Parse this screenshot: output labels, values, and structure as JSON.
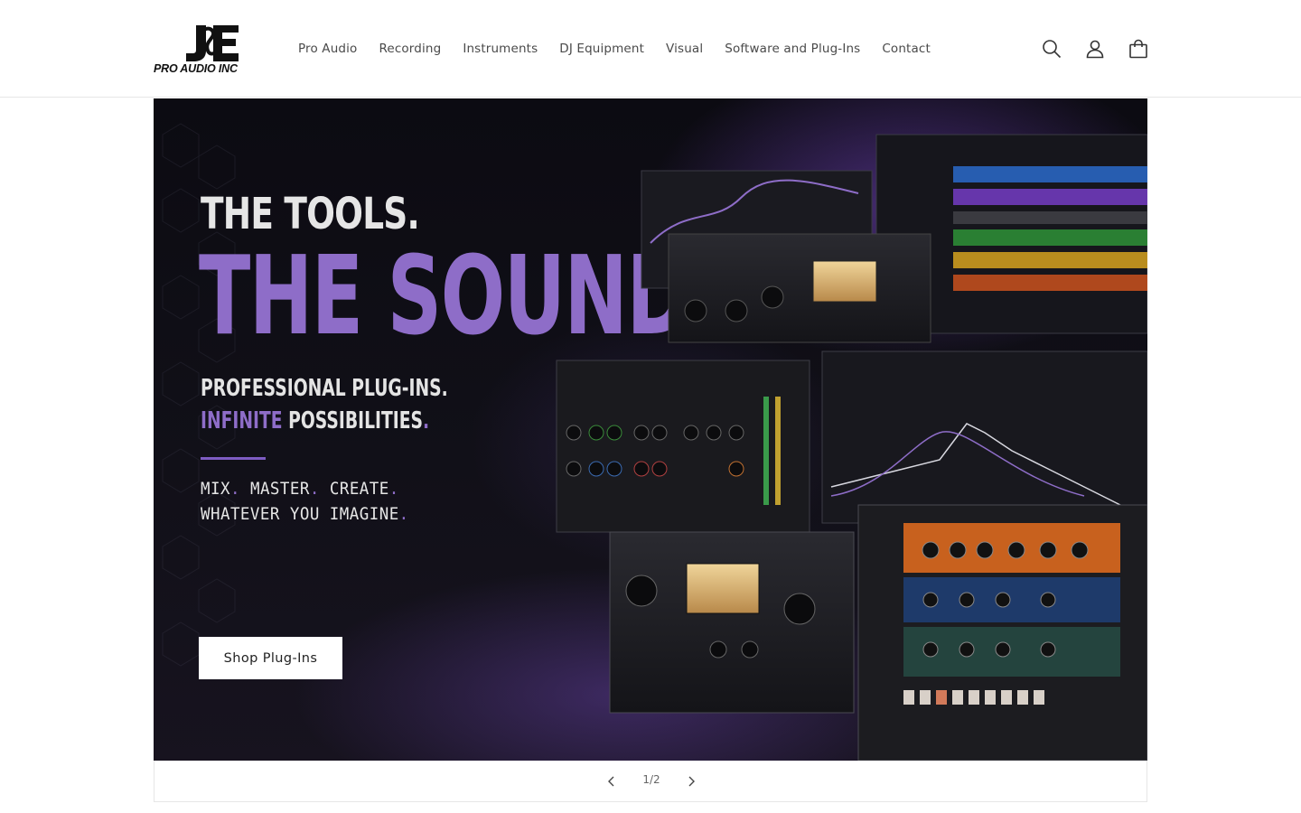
{
  "header": {
    "logo": {
      "mark": "J&E",
      "text": "PRO AUDIO INC"
    },
    "nav": [
      {
        "label": "Pro Audio"
      },
      {
        "label": "Recording"
      },
      {
        "label": "Instruments"
      },
      {
        "label": "DJ Equipment"
      },
      {
        "label": "Visual"
      },
      {
        "label": "Software and Plug-Ins"
      },
      {
        "label": "Contact"
      }
    ],
    "icons": [
      "search-icon",
      "account-icon",
      "cart-icon"
    ]
  },
  "hero": {
    "line1": "THE TOOLS.",
    "line2": "THE SOUND.",
    "sub1": "PROFESSIONAL PLUG-INS.",
    "sub2_accent": "INFINITE",
    "sub2_rest": "POSSIBILITIES",
    "tag1_words": [
      "MIX",
      "MASTER",
      "CREATE"
    ],
    "tag2": "WHATEVER YOU IMAGINE",
    "cta_label": "Shop Plug-Ins",
    "colors": {
      "accent": "#8e6dc8",
      "background": "#0e0d14"
    }
  },
  "slider": {
    "counter": "1/2",
    "prev_icon": "chevron-left-icon",
    "next_icon": "chevron-right-icon"
  }
}
